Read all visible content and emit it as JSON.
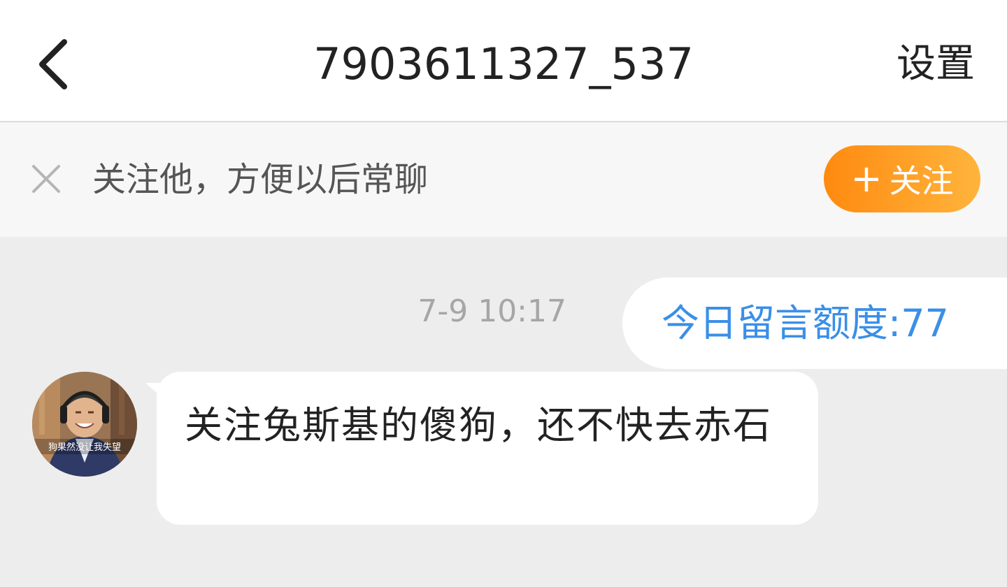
{
  "header": {
    "title": "7903611327_537",
    "settings_label": "设置",
    "back_icon": "chevron-left-icon"
  },
  "banner": {
    "close_icon": "close-icon",
    "text": "关注他，方便以后常聊",
    "follow_plus": "+",
    "follow_label": "关注",
    "follow_color_start": "#ff8a10",
    "follow_color_end": "#ffb43c"
  },
  "chat": {
    "timestamp": "7-9 10:17",
    "system_message": "今日留言额度:77",
    "system_color": "#3a8fe8",
    "message": {
      "avatar_caption": "狗果然没让我失望",
      "text": "关注兔斯基的傻狗，还不快去赤石"
    }
  }
}
